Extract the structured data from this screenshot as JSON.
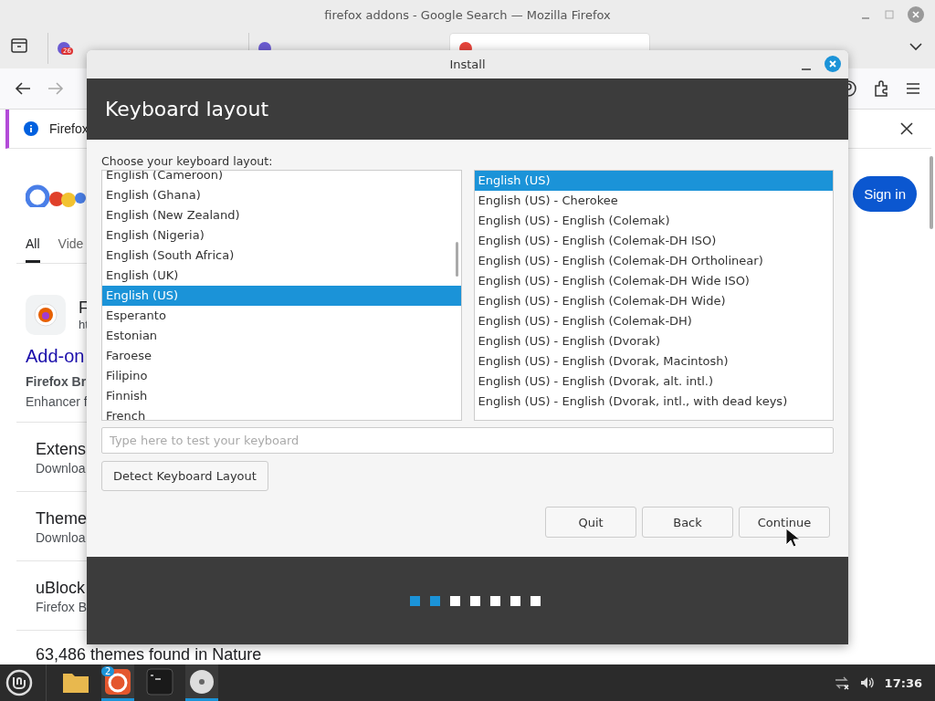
{
  "browser": {
    "title": "firefox addons - Google Search — Mozilla Firefox",
    "tabs": [
      {
        "selected": false,
        "badge": "26"
      },
      {
        "selected": false
      },
      {
        "selected": true
      }
    ],
    "notification": "Firefox",
    "page": {
      "nav_tabs": [
        {
          "label": "All",
          "selected": true
        },
        {
          "label": "Vide",
          "selected": false
        }
      ],
      "sign_in": "Sign in",
      "result": {
        "title": "F",
        "url": "ht",
        "link": "Add-on",
        "snippet_bold": "Firefox Br",
        "snippet": "Enhancer f"
      },
      "items": [
        {
          "title": "Extens",
          "subtitle": "Downloa"
        },
        {
          "title": "Theme",
          "subtitle": "Downloa"
        },
        {
          "title": "uBlock",
          "subtitle": "Firefox B"
        }
      ],
      "footer": "63,486 themes found in Nature"
    }
  },
  "dialog": {
    "title": "Install",
    "heading": "Keyboard layout",
    "prompt": "Choose your keyboard layout:",
    "layouts": [
      {
        "label": "English (Cameroon)",
        "selected": false
      },
      {
        "label": "English (Ghana)",
        "selected": false
      },
      {
        "label": "English (New Zealand)",
        "selected": false
      },
      {
        "label": "English (Nigeria)",
        "selected": false
      },
      {
        "label": "English (South Africa)",
        "selected": false
      },
      {
        "label": "English (UK)",
        "selected": false
      },
      {
        "label": "English (US)",
        "selected": true
      },
      {
        "label": "Esperanto",
        "selected": false
      },
      {
        "label": "Estonian",
        "selected": false
      },
      {
        "label": "Faroese",
        "selected": false
      },
      {
        "label": "Filipino",
        "selected": false
      },
      {
        "label": "Finnish",
        "selected": false
      },
      {
        "label": "French",
        "selected": false
      }
    ],
    "variants": [
      {
        "label": "English (US)",
        "selected": true
      },
      {
        "label": "English (US) - Cherokee",
        "selected": false
      },
      {
        "label": "English (US) - English (Colemak)",
        "selected": false
      },
      {
        "label": "English (US) - English (Colemak-DH ISO)",
        "selected": false
      },
      {
        "label": "English (US) - English (Colemak-DH Ortholinear)",
        "selected": false
      },
      {
        "label": "English (US) - English (Colemak-DH Wide ISO)",
        "selected": false
      },
      {
        "label": "English (US) - English (Colemak-DH Wide)",
        "selected": false
      },
      {
        "label": "English (US) - English (Colemak-DH)",
        "selected": false
      },
      {
        "label": "English (US) - English (Dvorak)",
        "selected": false
      },
      {
        "label": "English (US) - English (Dvorak, Macintosh)",
        "selected": false
      },
      {
        "label": "English (US) - English (Dvorak, alt. intl.)",
        "selected": false
      },
      {
        "label": "English (US) - English (Dvorak, intl., with dead keys)",
        "selected": false
      }
    ],
    "test_field": {
      "placeholder": "Type here to test your keyboard"
    },
    "detect_button": "Detect Keyboard Layout",
    "buttons": [
      "Quit",
      "Back",
      "Continue"
    ],
    "steps": [
      {
        "done": true
      },
      {
        "done": true
      },
      {
        "done": false
      },
      {
        "done": false
      },
      {
        "done": false
      },
      {
        "done": false
      },
      {
        "done": false
      }
    ]
  },
  "taskbar": {
    "apps": [
      {
        "kind": "folder",
        "active": false
      },
      {
        "kind": "firefox",
        "active": true,
        "badge": "2"
      },
      {
        "kind": "terminal",
        "active": false
      },
      {
        "kind": "disc",
        "active": true
      }
    ],
    "clock": "17:36"
  }
}
